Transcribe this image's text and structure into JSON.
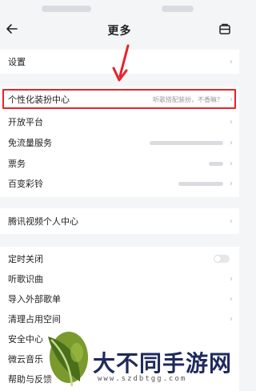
{
  "header": {
    "title": "更多"
  },
  "groups": [
    {
      "items": [
        {
          "label": "设置",
          "sub": ""
        }
      ]
    },
    {
      "items": [
        {
          "label": "个性化装扮中心",
          "sub": "听歌搭配装扮，不香嘛？"
        },
        {
          "label": "开放平台",
          "sub": ""
        },
        {
          "label": "免流量服务",
          "sub": ""
        },
        {
          "label": "票务",
          "sub": ""
        },
        {
          "label": "百变彩铃",
          "sub": ""
        }
      ]
    },
    {
      "items": [
        {
          "label": "腾讯视频个人中心",
          "sub": ""
        }
      ]
    },
    {
      "items": [
        {
          "label": "定时关闭",
          "sub": "",
          "toggle": false
        },
        {
          "label": "听歌识曲",
          "sub": ""
        },
        {
          "label": "导入外部歌单",
          "sub": ""
        },
        {
          "label": "清理占用空间",
          "sub": ""
        },
        {
          "label": "安全中心",
          "sub": ""
        },
        {
          "label": "微云音乐",
          "sub": ""
        },
        {
          "label": "帮助与反馈",
          "sub": ""
        }
      ]
    }
  ],
  "annotation": {
    "box_color": "#e8232a",
    "arrow_color": "#e8232a"
  },
  "watermark": {
    "title": "大不同手游网",
    "url": "www.szdbtgg.com"
  },
  "icons": {
    "back": "back-arrow-icon",
    "toolbox": "toolbox-icon",
    "chevron": "chevron-right-icon"
  }
}
